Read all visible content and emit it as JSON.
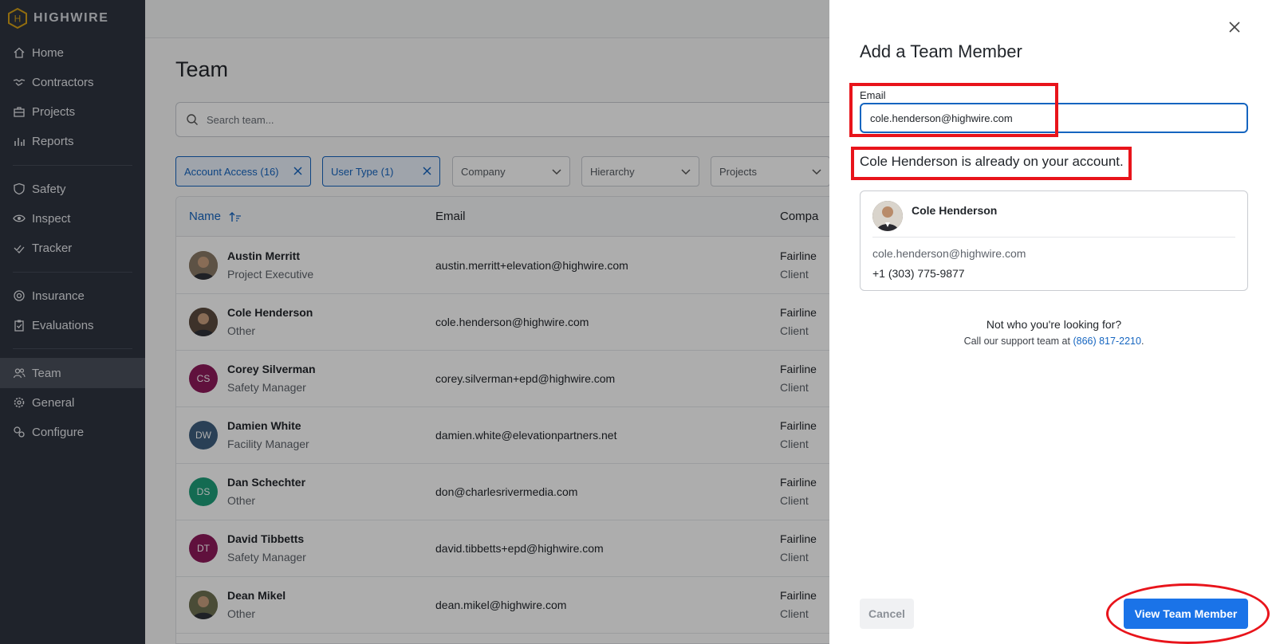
{
  "brand": {
    "name": "HIGHWIRE",
    "logo_letter": "H",
    "accent": "#d4a017"
  },
  "sidebar": {
    "items": [
      {
        "label": "Home",
        "icon": "home-icon"
      },
      {
        "label": "Contractors",
        "icon": "handshake-icon"
      },
      {
        "label": "Projects",
        "icon": "briefcase-icon"
      },
      {
        "label": "Reports",
        "icon": "bar-chart-icon"
      },
      {
        "label": "Safety",
        "icon": "shield-icon"
      },
      {
        "label": "Inspect",
        "icon": "eye-icon"
      },
      {
        "label": "Tracker",
        "icon": "check-icon"
      },
      {
        "label": "Insurance",
        "icon": "lifebuoy-icon"
      },
      {
        "label": "Evaluations",
        "icon": "clipboard-icon"
      },
      {
        "label": "Team",
        "icon": "users-icon",
        "active": true
      },
      {
        "label": "General",
        "icon": "gear-icon"
      },
      {
        "label": "Configure",
        "icon": "gears-icon"
      }
    ]
  },
  "main": {
    "title": "Team",
    "search_placeholder": "Search team...",
    "filters": [
      {
        "label": "Account Access (16)",
        "applied": true
      },
      {
        "label": "User Type (1)",
        "applied": true
      },
      {
        "label": "Company",
        "applied": false
      },
      {
        "label": "Hierarchy",
        "applied": false
      },
      {
        "label": "Projects",
        "applied": false
      }
    ],
    "columns": {
      "name": "Name",
      "email": "Email",
      "company": "Compa"
    },
    "rows": [
      {
        "initials": "",
        "photo": true,
        "name": "Austin Merritt",
        "role": "Project Executive",
        "email": "austin.merritt+elevation@highwire.com",
        "company": "Fairline",
        "ctype": "Client",
        "color": "#8a7a66"
      },
      {
        "initials": "",
        "photo": true,
        "name": "Cole Henderson",
        "role": "Other",
        "email": "cole.henderson@highwire.com",
        "company": "Fairline",
        "ctype": "Client",
        "color": "#5a4a3e"
      },
      {
        "initials": "CS",
        "photo": false,
        "name": "Corey Silverman",
        "role": "Safety Manager",
        "email": "corey.silverman+epd@highwire.com",
        "company": "Fairline",
        "ctype": "Client",
        "color": "#8e1a5b"
      },
      {
        "initials": "DW",
        "photo": false,
        "name": "Damien White",
        "role": "Facility Manager",
        "email": "damien.white@elevationpartners.net",
        "company": "Fairline",
        "ctype": "Client",
        "color": "#3f5f7f"
      },
      {
        "initials": "DS",
        "photo": false,
        "name": "Dan Schechter",
        "role": "Other",
        "email": "don@charlesrivermedia.com",
        "company": "Fairline",
        "ctype": "Client",
        "color": "#1e9e7a"
      },
      {
        "initials": "DT",
        "photo": false,
        "name": "David Tibbetts",
        "role": "Safety Manager",
        "email": "david.tibbetts+epd@highwire.com",
        "company": "Fairline",
        "ctype": "Client",
        "color": "#8e1a5b"
      },
      {
        "initials": "",
        "photo": true,
        "name": "Dean Mikel",
        "role": "Other",
        "email": "dean.mikel@highwire.com",
        "company": "Fairline",
        "ctype": "Client",
        "color": "#6d7052"
      }
    ]
  },
  "panel": {
    "title": "Add a Team Member",
    "email_label": "Email",
    "email_value": "cole.henderson@highwire.com",
    "already_msg": "Cole Henderson is already on your account.",
    "card": {
      "name": "Cole Henderson",
      "email": "cole.henderson@highwire.com",
      "phone": "+1 (303) 775-9877"
    },
    "not_who": "Not who you're looking for?",
    "support_prefix": "Call our support team at",
    "support_phone": "(866) 817-2210",
    "support_suffix": ".",
    "cancel_label": "Cancel",
    "view_label": "View Team Member"
  }
}
